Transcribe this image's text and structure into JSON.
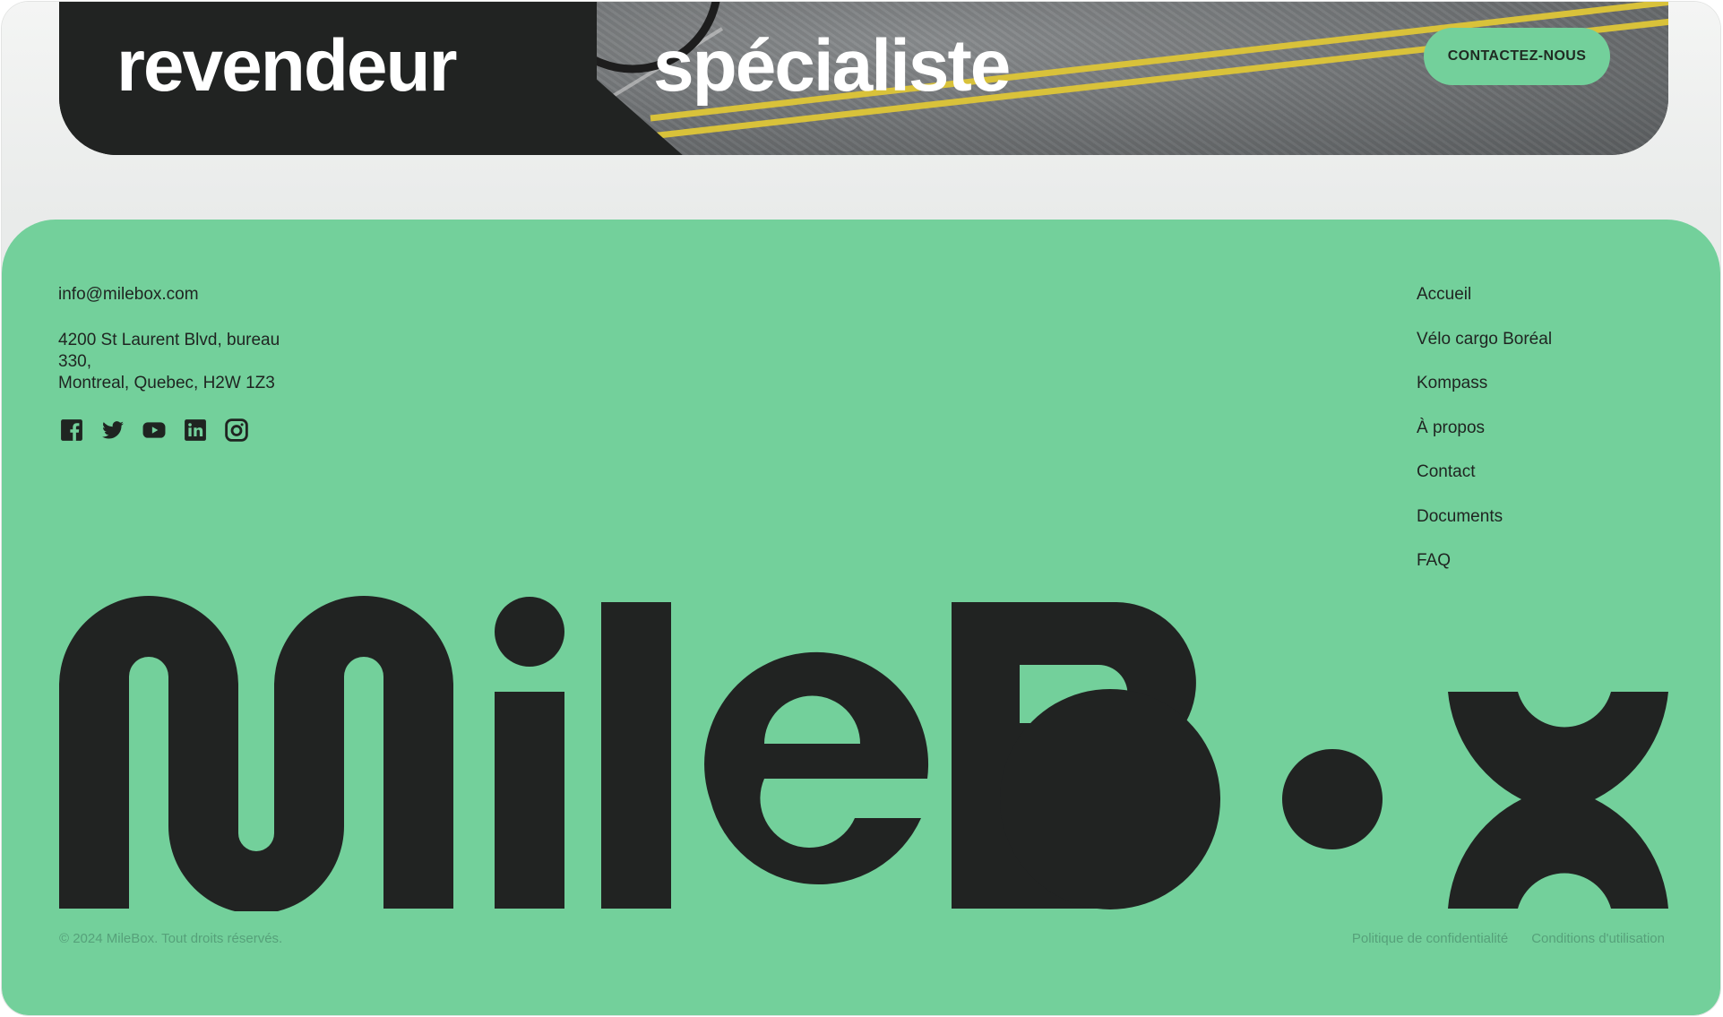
{
  "cta": {
    "left_title": "revendeur",
    "right_title": "spécialiste",
    "button_label": "CONTACTEZ-NOUS"
  },
  "footer": {
    "email": "info@milebox.com",
    "address": [
      "4200 St Laurent Blvd, bureau",
      "330,",
      "Montreal, Quebec, H2W 1Z3"
    ],
    "socials": [
      "facebook-icon",
      "twitter-icon",
      "youtube-icon",
      "linkedin-icon",
      "instagram-icon"
    ],
    "nav": [
      "Accueil",
      "Vélo cargo Boréal",
      "Kompass",
      "À propos",
      "Contact",
      "Documents",
      "FAQ"
    ],
    "logo_text": "MileBox",
    "copyright": "© 2024 MileBox. Tout droits réservés.",
    "legal_links": [
      "Politique de confidentialité",
      "Conditions d'utilisation"
    ]
  },
  "colors": {
    "brand_green": "#73d09b",
    "dark": "#212322",
    "muted_green_text": "#56a17a"
  }
}
